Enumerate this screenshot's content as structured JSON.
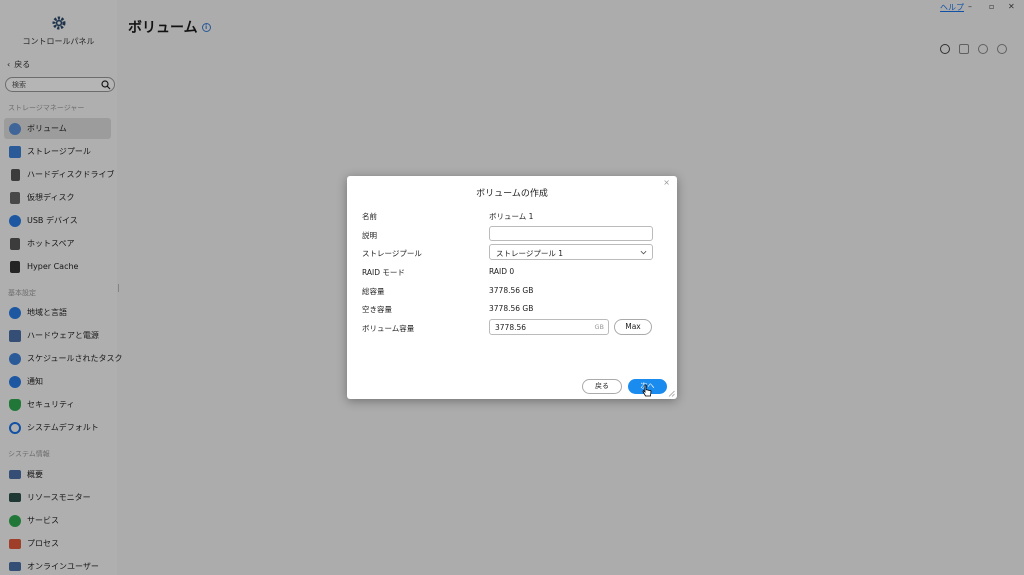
{
  "sidebar": {
    "title": "コントロールパネル",
    "back_label": "戻る",
    "search_placeholder": "検索",
    "sections": {
      "storage": "ストレージマネージャー",
      "basic": "基本設定",
      "system": "システム情報"
    },
    "storage_items": [
      {
        "label": "ボリューム",
        "icon": "volume-icon",
        "color": "#5b8fd6"
      },
      {
        "label": "ストレージプール",
        "icon": "storage-pool-icon",
        "color": "#3d7fd8"
      },
      {
        "label": "ハードディスクドライブ",
        "icon": "hdd-icon",
        "color": "#555555"
      },
      {
        "label": "仮想ディスク",
        "icon": "virtual-disk-icon",
        "color": "#666666"
      },
      {
        "label": "USB デバイス",
        "icon": "usb-icon",
        "color": "#2a7be4"
      },
      {
        "label": "ホットスペア",
        "icon": "hot-spare-icon",
        "color": "#555555"
      },
      {
        "label": "Hyper Cache",
        "icon": "hyper-cache-icon",
        "color": "#333333"
      }
    ],
    "basic_items": [
      {
        "label": "地域と言語",
        "icon": "globe-icon",
        "color": "#2a7be4"
      },
      {
        "label": "ハードウェアと電源",
        "icon": "tools-icon",
        "color": "#4a6fa5"
      },
      {
        "label": "スケジュールされたタスク",
        "icon": "schedule-icon",
        "color": "#3d7fd8"
      },
      {
        "label": "通知",
        "icon": "notification-icon",
        "color": "#2a7be4"
      },
      {
        "label": "セキュリティ",
        "icon": "shield-icon",
        "color": "#2fa84f"
      },
      {
        "label": "システムデフォルト",
        "icon": "reset-icon",
        "color": "#1a73e8"
      }
    ],
    "system_items": [
      {
        "label": "概要",
        "icon": "overview-icon",
        "color": "#4a6fa5"
      },
      {
        "label": "リソースモニター",
        "icon": "monitor-icon",
        "color": "#2d4f4a"
      },
      {
        "label": "サービス",
        "icon": "services-icon",
        "color": "#2fa84f"
      },
      {
        "label": "プロセス",
        "icon": "process-icon",
        "color": "#e05a3a"
      },
      {
        "label": "オンラインユーザー",
        "icon": "online-users-icon",
        "color": "#4a6fa5"
      }
    ]
  },
  "header": {
    "title": "ボリューム",
    "help": "ヘルプ"
  },
  "dialog": {
    "title": "ボリュームの作成",
    "labels": {
      "name": "名前",
      "description": "説明",
      "pool": "ストレージプール",
      "raid": "RAID モード",
      "total": "総容量",
      "free": "空き容量",
      "volume_capacity": "ボリューム容量"
    },
    "values": {
      "name": "ボリューム 1",
      "description": "",
      "pool": "ストレージプール 1",
      "raid": "RAID 0",
      "total": "3778.56 GB",
      "free": "3778.56 GB",
      "volume_capacity": "3778.56",
      "unit": "GB"
    },
    "buttons": {
      "max": "Max",
      "back": "戻る",
      "next": "次へ"
    }
  },
  "colors": {
    "accent": "#1a8cf0",
    "link": "#1a73e8"
  }
}
